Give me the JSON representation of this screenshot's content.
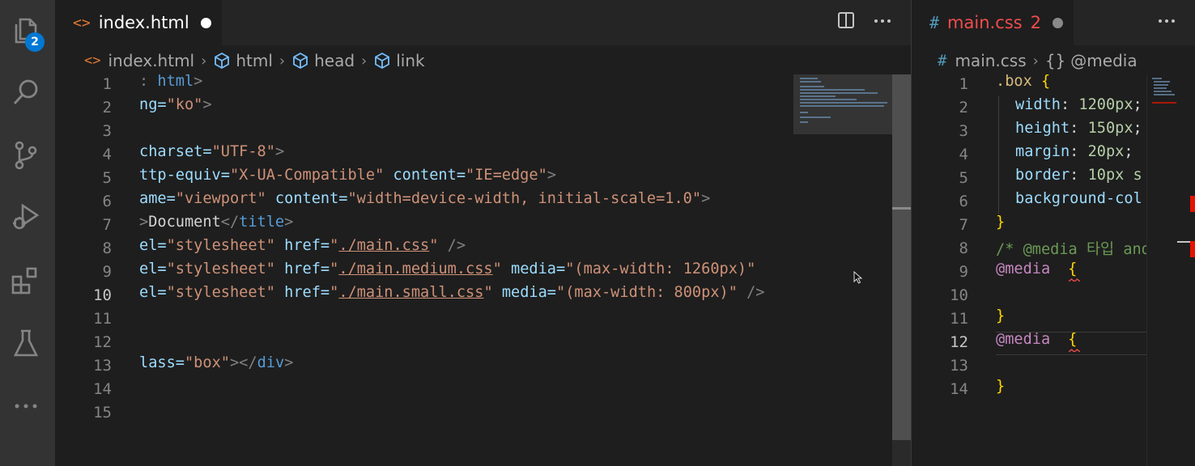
{
  "activity_bar": {
    "explorer_badge": "2",
    "items": [
      "explorer-icon",
      "search-icon",
      "source-control-icon",
      "run-debug-icon",
      "extensions-icon",
      "testing-icon",
      "more-icon"
    ]
  },
  "left_editor": {
    "tab": {
      "icon": "<>",
      "label": "index.html",
      "modified": true
    },
    "breadcrumb": {
      "file_icon": "<>",
      "items": [
        "index.html",
        "html",
        "head",
        "link"
      ]
    },
    "lines": [
      {
        "n": "1"
      },
      {
        "n": "2"
      },
      {
        "n": "3"
      },
      {
        "n": "4"
      },
      {
        "n": "5"
      },
      {
        "n": "6"
      },
      {
        "n": "7"
      },
      {
        "n": "8"
      },
      {
        "n": "9"
      },
      {
        "n": "10"
      },
      {
        "n": "11"
      },
      {
        "n": "12"
      },
      {
        "n": "13"
      },
      {
        "n": "14"
      },
      {
        "n": "15"
      }
    ],
    "code": {
      "l1": {
        "a": ": ",
        "b": "html",
        "c": ">"
      },
      "l2": {
        "a": "ng=",
        "b": "\"ko\"",
        "c": ">"
      },
      "l4": {
        "a": "charset=",
        "b": "\"UTF-8\"",
        "c": ">"
      },
      "l5": {
        "a": "ttp-equiv=",
        "b": "\"X-UA-Compatible\"",
        "c": " content=",
        "d": "\"IE=edge\"",
        "e": ">"
      },
      "l6": {
        "a": "ame=",
        "b": "\"viewport\"",
        "c": " content=",
        "d": "\"width=device-width, initial-scale=1.0\"",
        "e": ">"
      },
      "l7": {
        "a": ">",
        "b": "Document",
        "c": "</",
        "d": "title",
        "e": ">"
      },
      "l8": {
        "a": "el=",
        "b": "\"stylesheet\"",
        "c": " href=",
        "d": "\"",
        "e": "./main.css",
        "f": "\"",
        "g": " />"
      },
      "l9": {
        "a": "el=",
        "b": "\"stylesheet\"",
        "c": " href=",
        "d": "\"",
        "e": "./main.medium.css",
        "f": "\"",
        "g": " media=",
        "h": "\"(max-width: 1260px)\""
      },
      "l10": {
        "a": "el=",
        "b": "\"stylesheet\"",
        "c": " href=",
        "d": "\"",
        "e": "./main.small.css",
        "f": "\"",
        "g": " media=",
        "h": "\"(max-width: 800px)\"",
        "i": " />"
      },
      "l13": {
        "a": "lass=",
        "b": "\"box\"",
        "c": "></",
        "d": "div",
        "e": ">"
      }
    },
    "active_line": "10"
  },
  "right_editor": {
    "tab": {
      "icon": "#",
      "label": "main.css",
      "problems": "2",
      "modified": true
    },
    "breadcrumb": {
      "file_icon": "#",
      "file": "main.css",
      "symbol_icon": "{}",
      "symbol": "@media"
    },
    "lines": [
      {
        "n": "1"
      },
      {
        "n": "2"
      },
      {
        "n": "3"
      },
      {
        "n": "4"
      },
      {
        "n": "5"
      },
      {
        "n": "6"
      },
      {
        "n": "7"
      },
      {
        "n": "8"
      },
      {
        "n": "9"
      },
      {
        "n": "10"
      },
      {
        "n": "11"
      },
      {
        "n": "12"
      },
      {
        "n": "13"
      },
      {
        "n": "14"
      }
    ],
    "code": {
      "l1": {
        "sel": ".box",
        "brace": " {"
      },
      "l2": {
        "prop": "width",
        "colon": ": ",
        "val": "1200px",
        "semi": ";"
      },
      "l3": {
        "prop": "height",
        "colon": ": ",
        "val": "150px",
        "semi": ";"
      },
      "l4": {
        "prop": "margin",
        "colon": ": ",
        "val": "20px",
        "semi": ";"
      },
      "l5": {
        "prop": "border",
        "colon": ": ",
        "val": "10px s"
      },
      "l6": {
        "prop": "background-col"
      },
      "l7": {
        "brace": "}"
      },
      "l8": {
        "comment": "/* @media 타입 and"
      },
      "l9": {
        "at": "@media",
        "brace": "{"
      },
      "l11": {
        "brace": "}"
      },
      "l12": {
        "at": "@media",
        "brace": "{"
      },
      "l14": {
        "brace": "}"
      }
    },
    "active_line": "12"
  },
  "colors": {
    "tab_active_bg": "#1e1e1e",
    "tabbar_bg": "#252526",
    "activity_bg": "#333333",
    "badge": "#0078d4",
    "css_tab_error": "#f14c4c",
    "html_icon": "#e37933",
    "css_icon": "#519aba",
    "error": "#e51400"
  }
}
